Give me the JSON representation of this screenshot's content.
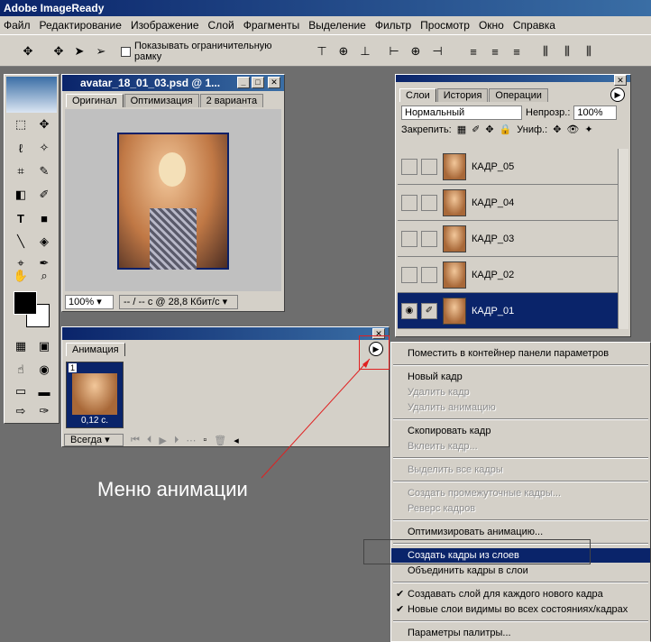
{
  "app": {
    "title": "Adobe ImageReady"
  },
  "menu": [
    "Файл",
    "Редактирование",
    "Изображение",
    "Слой",
    "Фрагменты",
    "Выделение",
    "Фильтр",
    "Просмотр",
    "Окно",
    "Справка"
  ],
  "options": {
    "show_bounds_label": "Показывать ограничительную рамку"
  },
  "doc": {
    "title": "avatar_18_01_03.psd @ 1...",
    "tabs": [
      "Оригинал",
      "Оптимизация",
      "2 варианта"
    ],
    "zoom": "100%",
    "status": "-- / -- с @ 28,8 Кбит/с"
  },
  "layers": {
    "tabs": [
      "Слои",
      "История",
      "Операции"
    ],
    "mode": "Нормальный",
    "opacity_label": "Непрозр.:",
    "opacity": "100%",
    "lock_label": "Закрепить:",
    "unify_label": "Униф.:",
    "rows": [
      "КАДР_05",
      "КАДР_04",
      "КАДР_03",
      "КАДР_02",
      "КАДР_01"
    ]
  },
  "animation": {
    "tab": "Анимация",
    "frame_num": "1",
    "delay": "0,12 с.",
    "loop": "Всегда"
  },
  "menu_popup": {
    "items": [
      "Поместить в контейнер панели параметров",
      "Новый кадр",
      "Удалить кадр",
      "Удалить анимацию",
      "Скопировать кадр",
      "Вклеить кадр...",
      "Выделить все кадры",
      "Создать промежуточные кадры...",
      "Реверс кадров",
      "Оптимизировать анимацию...",
      "Создать кадры из слоев",
      "Объединить кадры в слои",
      "Создавать слой для каждого нового кадра",
      "Новые слои видимы во всех состояниях/кадрах",
      "Параметры палитры..."
    ]
  },
  "annotation": {
    "label": "Меню анимации"
  }
}
